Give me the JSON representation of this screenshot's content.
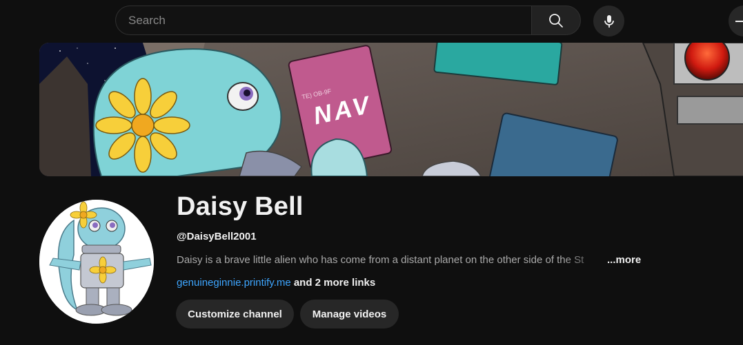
{
  "search": {
    "placeholder": "Search"
  },
  "icons": {
    "search": "search-icon",
    "voice": "microphone-icon",
    "create": "plus-icon"
  },
  "banner": {
    "card_text": "NAV",
    "card_small_text": "TE) OB-9F"
  },
  "channel": {
    "name": "Daisy Bell",
    "handle": "@DaisyBell2001",
    "description": "Daisy is a brave little alien who has come from a distant planet on the other side of the St",
    "more_label": "...more",
    "link_text": "genuineginnie.printify.me",
    "more_links_text": " and 2 more links"
  },
  "buttons": {
    "customize": "Customize channel",
    "manage": "Manage videos"
  },
  "colors": {
    "background": "#0f0f0f",
    "link": "#3ea6ff",
    "button_bg": "#272727",
    "muted_text": "#aaaaaa"
  }
}
